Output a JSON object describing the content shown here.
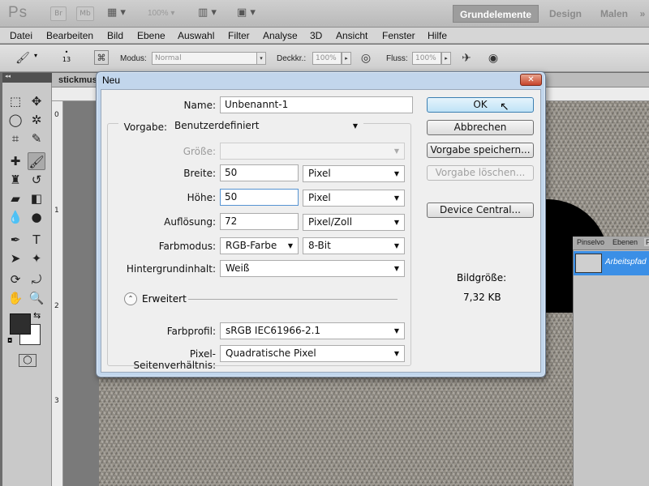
{
  "appbar": {
    "logo": "Ps",
    "br": "Br",
    "mb": "Mb",
    "zoom": "100%",
    "workspaces": [
      "Grundelemente",
      "Design",
      "Malen"
    ],
    "more": "»"
  },
  "menu": [
    "Datei",
    "Bearbeiten",
    "Bild",
    "Ebene",
    "Auswahl",
    "Filter",
    "Analyse",
    "3D",
    "Ansicht",
    "Fenster",
    "Hilfe"
  ],
  "options": {
    "brush_size": "13",
    "mode_label": "Modus:",
    "mode_value": "Normal",
    "opacity_label": "Deckkr.:",
    "opacity_value": "100%",
    "flow_label": "Fluss:",
    "flow_value": "100%"
  },
  "document": {
    "tab_title": "stickmus",
    "ruler_top": [
      "0"
    ],
    "ruler_left": [
      "0",
      "1",
      "2",
      "3"
    ]
  },
  "right_panel": {
    "tabs": [
      "Pinselvo",
      "Ebenen",
      "P"
    ],
    "path_name": "Arbeitspfad"
  },
  "dialog": {
    "title": "Neu",
    "name_label": "Name:",
    "name_value": "Unbenannt-1",
    "preset_label": "Vorgabe:",
    "preset_value": "Benutzerdefiniert",
    "size_label": "Größe:",
    "width_label": "Breite:",
    "width_value": "50",
    "width_unit": "Pixel",
    "height_label": "Höhe:",
    "height_value": "50",
    "height_unit": "Pixel",
    "resolution_label": "Auflösung:",
    "resolution_value": "72",
    "resolution_unit": "Pixel/Zoll",
    "colormode_label": "Farbmodus:",
    "colormode_value": "RGB-Farbe",
    "bitdepth_value": "8-Bit",
    "background_label": "Hintergrundinhalt:",
    "background_value": "Weiß",
    "advanced_label": "Erweitert",
    "profile_label": "Farbprofil:",
    "profile_value": "sRGB IEC61966-2.1",
    "aspect_label": "Pixel-Seitenverhältnis:",
    "aspect_value": "Quadratische Pixel",
    "ok": "OK",
    "cancel": "Abbrechen",
    "save_preset": "Vorgabe speichern...",
    "delete_preset": "Vorgabe löschen...",
    "device_central": "Device Central...",
    "image_size_label": "Bildgröße:",
    "image_size_value": "7,32 KB"
  }
}
